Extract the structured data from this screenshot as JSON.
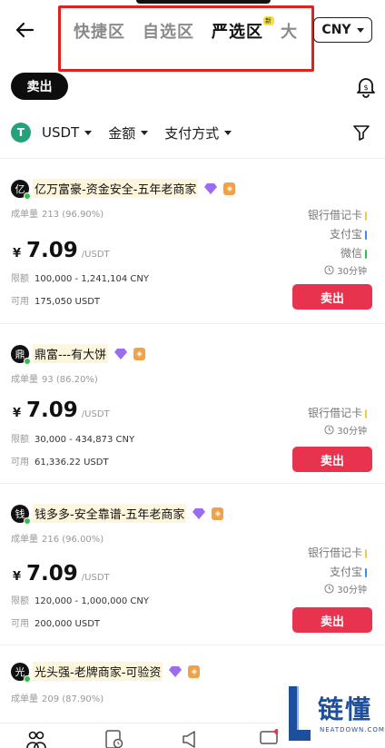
{
  "header": {
    "tabs": [
      {
        "label": "快捷区"
      },
      {
        "label": "自选区"
      },
      {
        "label": "严选区",
        "badge": "新"
      },
      {
        "label": "大"
      }
    ],
    "active_tab": "严选区",
    "currency": "CNY"
  },
  "trade": {
    "sell_label": "卖出"
  },
  "filters": {
    "coin": "USDT",
    "coin_icon": "tether-icon",
    "amount": "金额",
    "payment": "支付方式"
  },
  "labels": {
    "orders": "成单量",
    "limit": "限额",
    "available": "可用",
    "price_unit": "/USDT",
    "currency_symbol": "¥",
    "action": "卖出"
  },
  "ads": [
    {
      "avatar": "亿",
      "name": "亿万富豪-资金安全-五年老商家",
      "orders": "213 (96.90%)",
      "price": "7.09",
      "limit": "100,000 - 1,241,104 CNY",
      "available": "175,050 USDT",
      "methods": [
        {
          "label": "银行借记卡",
          "color": "#f2c94c"
        },
        {
          "label": "支付宝",
          "color": "#3b8ef0"
        },
        {
          "label": "微信",
          "color": "#2fbf4a"
        }
      ],
      "timer": "30分钟"
    },
    {
      "avatar": "鼎",
      "name": "鼎富---有大饼",
      "orders": "93 (86.20%)",
      "price": "7.09",
      "limit": "30,000 - 434,873 CNY",
      "available": "61,336.22 USDT",
      "methods": [
        {
          "label": "银行借记卡",
          "color": "#f2c94c"
        }
      ],
      "timer": "30分钟"
    },
    {
      "avatar": "钱",
      "name": "钱多多-安全靠谱-五年老商家",
      "orders": "216 (96.00%)",
      "price": "7.09",
      "limit": "120,000 - 1,000,000 CNY",
      "available": "200,000 USDT",
      "methods": [
        {
          "label": "银行借记卡",
          "color": "#f2c94c"
        },
        {
          "label": "支付宝",
          "color": "#3b8ef0"
        }
      ],
      "timer": "30分钟"
    },
    {
      "avatar": "光",
      "name": "光头强-老牌商家-可验资",
      "orders": "209 (87.90%)"
    }
  ],
  "watermark": {
    "text": "链懂",
    "sub": "NEATDOWN.COM"
  },
  "colors": {
    "accent": "#e8334f",
    "highlight_frame": "#e0221f",
    "online": "#2fbf4a"
  }
}
